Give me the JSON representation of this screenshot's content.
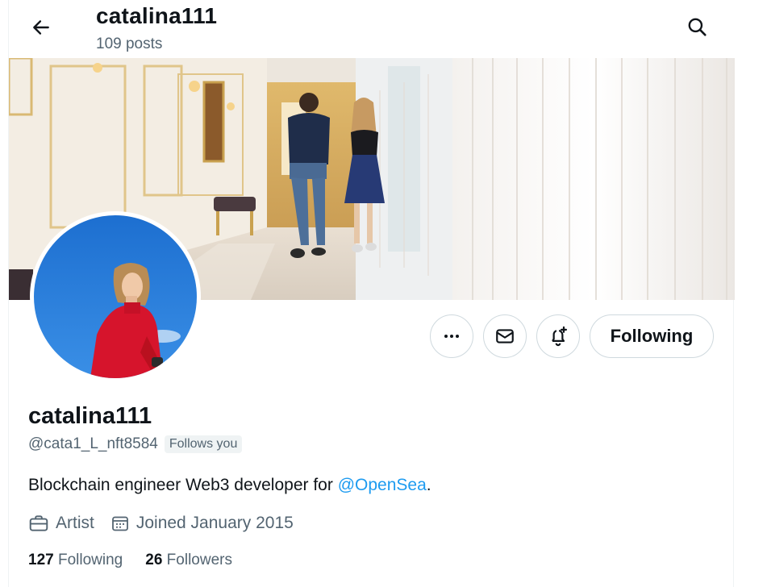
{
  "header": {
    "title": "catalina111",
    "post_count": "109 posts",
    "back_icon": "arrow-left-icon",
    "search_icon": "search-icon"
  },
  "profile": {
    "display_name": "catalina111",
    "handle": "@cata1_L_nft8584",
    "follows_you": "Follows you",
    "bio_text": "Blockchain engineer Web3 developer for ",
    "bio_mention": "@OpenSea",
    "bio_end": ".",
    "profession": "Artist",
    "joined": "Joined January 2015",
    "following_count": "127",
    "following_label": "Following",
    "followers_count": "26",
    "followers_label": "Followers"
  },
  "actions": {
    "more_icon": "more-dots-icon",
    "message_icon": "mail-icon",
    "notify_icon": "bell-plus-icon",
    "following_button": "Following"
  },
  "colors": {
    "accent": "#1d9bf0",
    "muted_text": "#536471",
    "border": "#cfd9de",
    "text": "#0f1419"
  }
}
